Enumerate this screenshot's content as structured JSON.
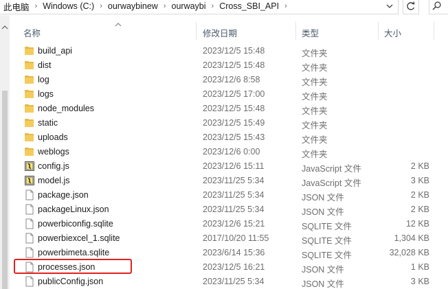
{
  "address": {
    "crumbs": [
      "此电脑",
      "Windows (C:)",
      "ourwaybinew",
      "ourwaybi",
      "Cross_SBI_API"
    ]
  },
  "columns": {
    "name": "名称",
    "date": "修改日期",
    "type": "类型",
    "size": "大小"
  },
  "files": [
    {
      "name": "build_api",
      "date": "2023/12/5 15:48",
      "type": "文件夹",
      "size": "",
      "icon": "folder-icon"
    },
    {
      "name": "dist",
      "date": "2023/12/5 15:48",
      "type": "文件夹",
      "size": "",
      "icon": "folder-icon"
    },
    {
      "name": "log",
      "date": "2023/12/6 8:58",
      "type": "文件夹",
      "size": "",
      "icon": "folder-icon"
    },
    {
      "name": "logs",
      "date": "2023/12/5 17:00",
      "type": "文件夹",
      "size": "",
      "icon": "folder-icon"
    },
    {
      "name": "node_modules",
      "date": "2023/12/5 15:48",
      "type": "文件夹",
      "size": "",
      "icon": "folder-icon"
    },
    {
      "name": "static",
      "date": "2023/12/5 15:49",
      "type": "文件夹",
      "size": "",
      "icon": "folder-icon"
    },
    {
      "name": "uploads",
      "date": "2023/12/5 15:43",
      "type": "文件夹",
      "size": "",
      "icon": "folder-icon"
    },
    {
      "name": "weblogs",
      "date": "2023/12/6 0:00",
      "type": "文件夹",
      "size": "",
      "icon": "folder-icon"
    },
    {
      "name": "config.js",
      "date": "2023/12/6 15:11",
      "type": "JavaScript 文件",
      "size": "2 KB",
      "icon": "javascript-file-icon"
    },
    {
      "name": "model.js",
      "date": "2023/11/25 5:34",
      "type": "JavaScript 文件",
      "size": "3 KB",
      "icon": "javascript-file-icon"
    },
    {
      "name": "package.json",
      "date": "2023/11/25 5:34",
      "type": "JSON 文件",
      "size": "2 KB",
      "icon": "file-icon"
    },
    {
      "name": "packageLinux.json",
      "date": "2023/11/25 5:34",
      "type": "JSON 文件",
      "size": "2 KB",
      "icon": "file-icon"
    },
    {
      "name": "powerbiconfig.sqlite",
      "date": "2023/12/6 15:21",
      "type": "SQLITE 文件",
      "size": "12 KB",
      "icon": "file-icon"
    },
    {
      "name": "powerbiexcel_1.sqlite",
      "date": "2017/10/20 11:55",
      "type": "SQLITE 文件",
      "size": "1,304 KB",
      "icon": "file-icon"
    },
    {
      "name": "powerbimeta.sqlite",
      "date": "2023/6/14 15:36",
      "type": "SQLITE 文件",
      "size": "32,028 KB",
      "icon": "file-icon"
    },
    {
      "name": "processes.json",
      "date": "2023/12/5 16:21",
      "type": "JSON 文件",
      "size": "1 KB",
      "icon": "file-icon"
    },
    {
      "name": "publicConfig.json",
      "date": "2023/11/25 5:34",
      "type": "JSON 文件",
      "size": "3 KB",
      "icon": "file-icon"
    }
  ],
  "colors": {
    "folder": "#e8b84a",
    "highlight": "#e02020",
    "header_text": "#4a5a6a"
  }
}
